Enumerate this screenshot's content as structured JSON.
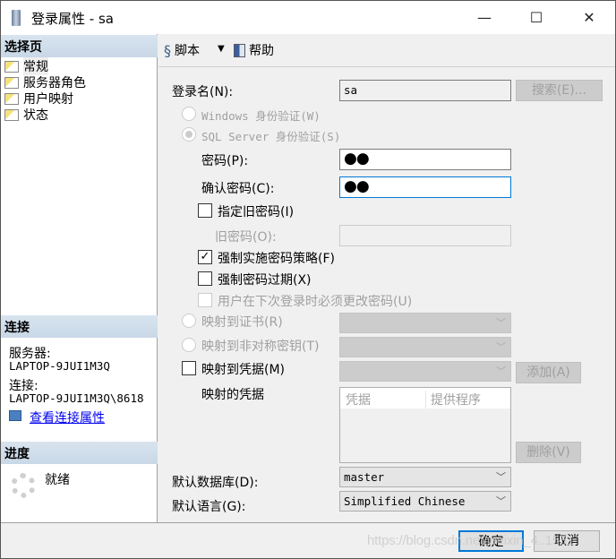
{
  "window": {
    "title": "登录属性 - sa",
    "controls": {
      "minimize": "—",
      "maximize": "☐",
      "close": "✕"
    }
  },
  "sidebar": {
    "select_page_header": "选择页",
    "items": [
      {
        "label": "常规",
        "selected": true
      },
      {
        "label": "服务器角色"
      },
      {
        "label": "用户映射"
      },
      {
        "label": "状态"
      }
    ],
    "connection_header": "连接",
    "server_label": "服务器:",
    "server_value": "LAPTOP-9JUI1M3Q",
    "connection_label": "连接:",
    "connection_value": "LAPTOP-9JUI1M3Q\\8618",
    "view_connection_link": "查看连接属性",
    "progress_header": "进度",
    "progress_status": "就绪"
  },
  "toolbar": {
    "script_label": "脚本",
    "dropdown_arrow": "▼",
    "help_label": "帮助"
  },
  "form": {
    "login_name_label": "登录名(N):",
    "login_name_value": "sa",
    "search_button": "搜索(E)...",
    "windows_auth_label": "Windows 身份验证(W)",
    "sql_auth_label": "SQL Server 身份验证(S)",
    "password_label": "密码(P):",
    "password_value": "●●",
    "confirm_password_label": "确认密码(C):",
    "confirm_password_value": "●●",
    "specify_old_password_label": "指定旧密码(I)",
    "old_password_label": "旧密码(O):",
    "enforce_policy_label": "强制实施密码策略(F)",
    "enforce_policy_checked": true,
    "enforce_expiration_label": "强制密码过期(X)",
    "must_change_label": "用户在下次登录时必须更改密码(U)",
    "map_certificate_label": "映射到证书(R)",
    "map_asym_key_label": "映射到非对称密钥(T)",
    "map_credential_label": "映射到凭据(M)",
    "add_button": "添加(A)",
    "mapped_credentials_label": "映射的凭据",
    "credentials_table": {
      "columns": [
        "凭据",
        "提供程序"
      ],
      "rows": []
    },
    "remove_button": "删除(V)",
    "default_database_label": "默认数据库(D):",
    "default_database_value": "master",
    "default_language_label": "默认语言(G):",
    "default_language_value": "Simplified Chinese"
  },
  "footer": {
    "ok_button": "确定",
    "cancel_button": "取消"
  },
  "watermark": "https://blog.csdn.net/weixin_4..1551"
}
